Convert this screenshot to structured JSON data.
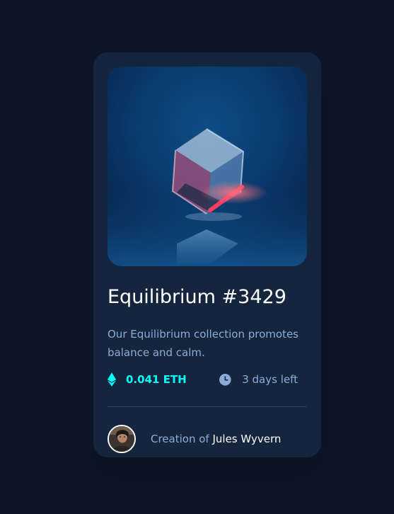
{
  "card": {
    "title": "Equilibrium #3429",
    "description": "Our Equilibrium collection promotes balance and calm.",
    "price": "0.041 ETH",
    "time_left": "3 days left",
    "creator_prefix": "Creation of",
    "creator_name": "Jules Wyvern"
  },
  "icons": {
    "price": "ethereum-icon",
    "time": "clock-icon"
  },
  "colors": {
    "page_background": "#0d1628",
    "card_background": "#15253e",
    "divider": "#2e405a",
    "accent_cyan": "#00fff8",
    "soft_blue": "#8bacd9",
    "white": "#ffffff"
  }
}
